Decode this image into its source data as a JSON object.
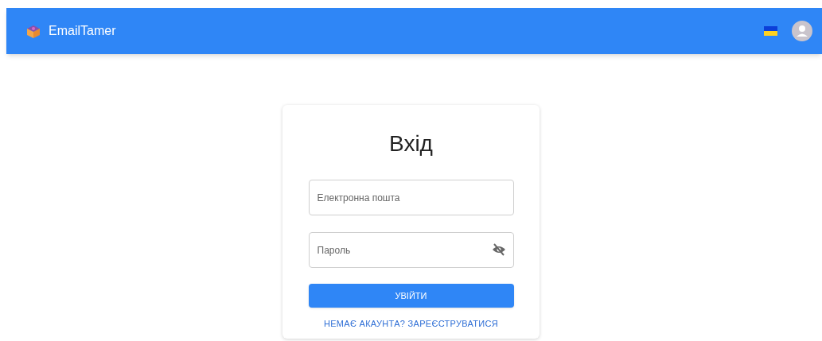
{
  "app_bar": {
    "brand": "EmailTamer"
  },
  "login": {
    "title": "Вхід",
    "email_field": {
      "placeholder": "Електронна пошта"
    },
    "password_field": {
      "placeholder": "Пароль"
    },
    "submit_button": "УВІЙТИ",
    "register_link": "НЕМАЄ АКАУНТА? ЗАРЕЄСТРУВАТИСЯ"
  }
}
